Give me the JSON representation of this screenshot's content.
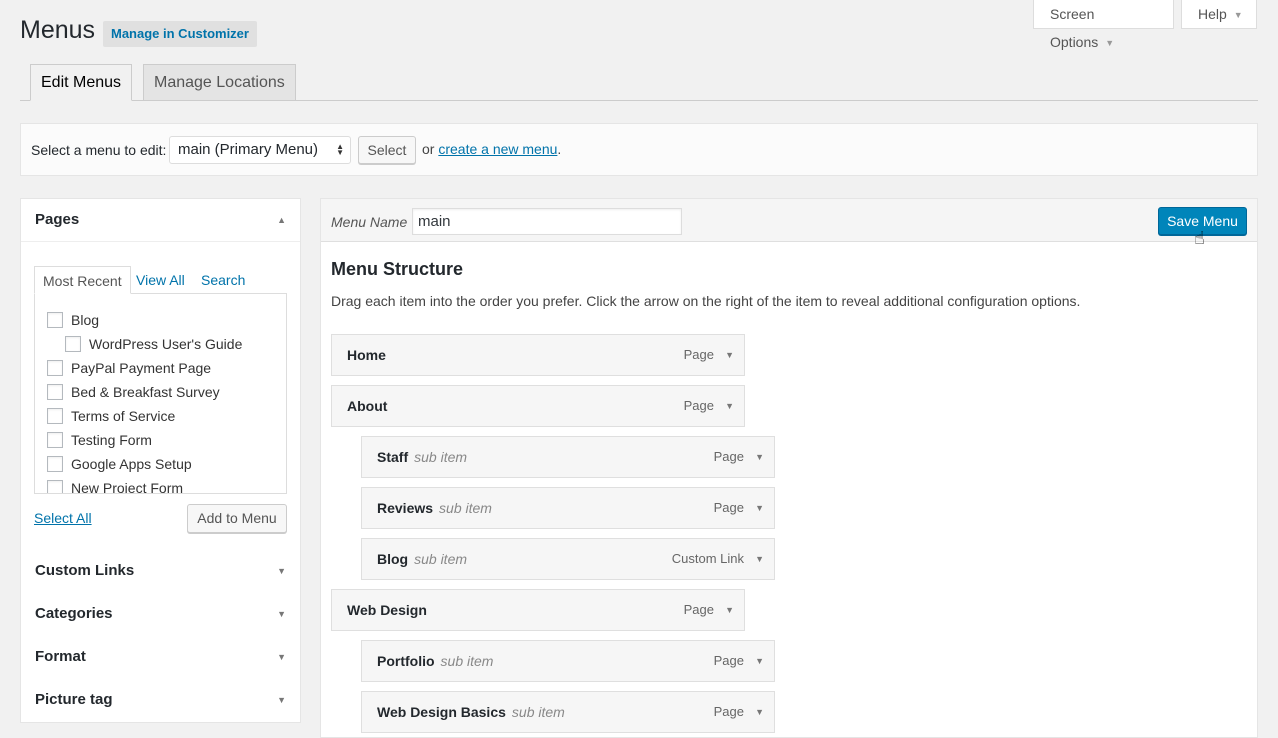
{
  "header": {
    "title": "Menus",
    "customizer_label": "Manage in Customizer",
    "screen_options_label": "Screen Options",
    "help_label": "Help"
  },
  "tabs": {
    "edit_menus": "Edit Menus",
    "manage_locations": "Manage Locations"
  },
  "select_bar": {
    "label": "Select a menu to edit:",
    "selected_menu": "main (Primary Menu)",
    "select_button": "Select",
    "or_text": "or",
    "create_link": "create a new menu",
    "period": "."
  },
  "sidebar": {
    "pages": {
      "title": "Pages",
      "tabs": [
        "Most Recent",
        "View All",
        "Search"
      ],
      "items": [
        {
          "label": "Blog",
          "indent": 0
        },
        {
          "label": "WordPress User's Guide",
          "indent": 1
        },
        {
          "label": "PayPal Payment Page",
          "indent": 0
        },
        {
          "label": "Bed & Breakfast Survey",
          "indent": 0
        },
        {
          "label": "Terms of Service",
          "indent": 0
        },
        {
          "label": "Testing Form",
          "indent": 0
        },
        {
          "label": "Google Apps Setup",
          "indent": 0
        },
        {
          "label": "New Project Form",
          "indent": 0
        }
      ],
      "select_all": "Select All",
      "add_button": "Add to Menu"
    },
    "sections": [
      "Custom Links",
      "Categories",
      "Format",
      "Picture tag"
    ]
  },
  "main": {
    "menu_name_label": "Menu Name",
    "menu_name_value": "main",
    "save_button": "Save Menu",
    "structure_title": "Menu Structure",
    "structure_desc": "Drag each item into the order you prefer. Click the arrow on the right of the item to reveal additional configuration options.",
    "items": [
      {
        "title": "Home",
        "sub": "",
        "type": "Page",
        "depth": 0
      },
      {
        "title": "About",
        "sub": "",
        "type": "Page",
        "depth": 0
      },
      {
        "title": "Staff",
        "sub": "sub item",
        "type": "Page",
        "depth": 1
      },
      {
        "title": "Reviews",
        "sub": "sub item",
        "type": "Page",
        "depth": 1
      },
      {
        "title": "Blog",
        "sub": "sub item",
        "type": "Custom Link",
        "depth": 1
      },
      {
        "title": "Web Design",
        "sub": "",
        "type": "Page",
        "depth": 0
      },
      {
        "title": "Portfolio",
        "sub": "sub item",
        "type": "Page",
        "depth": 1
      },
      {
        "title": "Web Design Basics",
        "sub": "sub item",
        "type": "Page",
        "depth": 1
      }
    ]
  },
  "icons": {
    "toggle_down": "▼",
    "toggle_up": "▲"
  }
}
